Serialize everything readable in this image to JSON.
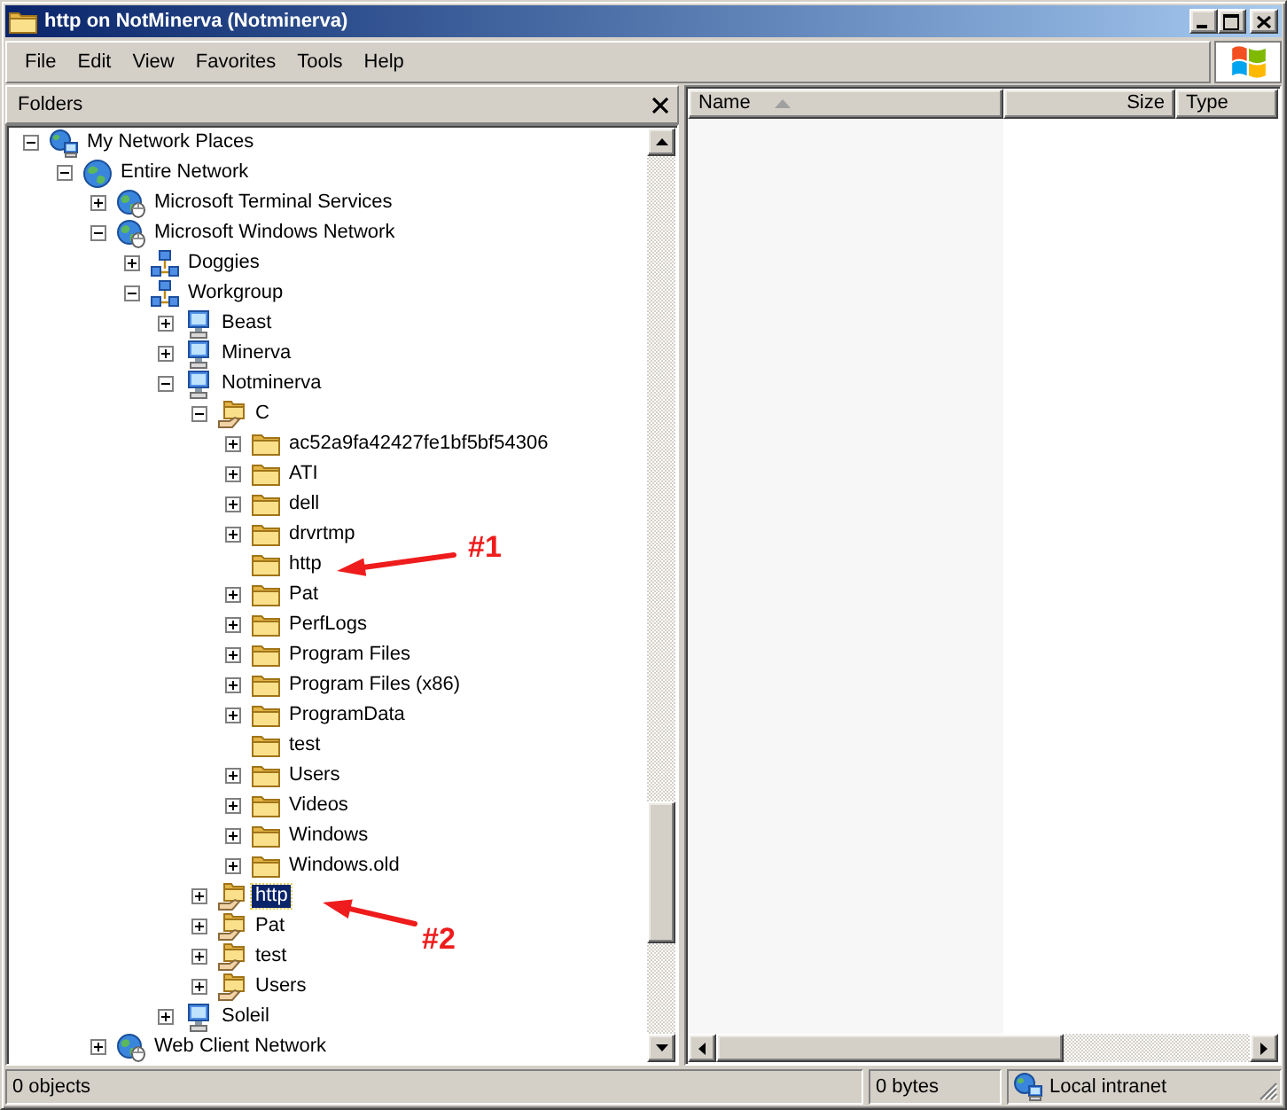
{
  "window": {
    "title": "http on NotMinerva (Notminerva)"
  },
  "menu": [
    "File",
    "Edit",
    "View",
    "Favorites",
    "Tools",
    "Help"
  ],
  "folders_pane": {
    "title": "Folders",
    "tree": [
      {
        "label": "My Network Places",
        "kind": "places",
        "expanded": true,
        "selected": false,
        "children": [
          {
            "label": "Entire Network",
            "kind": "globe",
            "expanded": true,
            "selected": false,
            "children": [
              {
                "label": "Microsoft Terminal Services",
                "kind": "network",
                "expanded": false,
                "selected": false
              },
              {
                "label": "Microsoft Windows Network",
                "kind": "network",
                "expanded": true,
                "selected": false,
                "children": [
                  {
                    "label": "Doggies",
                    "kind": "workgroup",
                    "expanded": false,
                    "selected": false
                  },
                  {
                    "label": "Workgroup",
                    "kind": "workgroup",
                    "expanded": true,
                    "selected": false,
                    "children": [
                      {
                        "label": "Beast",
                        "kind": "computer",
                        "expanded": false,
                        "selected": false
                      },
                      {
                        "label": "Minerva",
                        "kind": "computer",
                        "expanded": false,
                        "selected": false
                      },
                      {
                        "label": "Notminerva",
                        "kind": "computer",
                        "expanded": true,
                        "selected": false,
                        "children": [
                          {
                            "label": "C",
                            "kind": "share",
                            "expanded": true,
                            "selected": false,
                            "children": [
                              {
                                "label": "ac52a9fa42427fe1bf5bf54306",
                                "kind": "folder",
                                "expanded": false,
                                "selected": false
                              },
                              {
                                "label": "ATI",
                                "kind": "folder",
                                "expanded": false,
                                "selected": false
                              },
                              {
                                "label": "dell",
                                "kind": "folder",
                                "expanded": false,
                                "selected": false
                              },
                              {
                                "label": "drvrtmp",
                                "kind": "folder",
                                "expanded": false,
                                "selected": false
                              },
                              {
                                "label": "http",
                                "kind": "folder",
                                "selected": false
                              },
                              {
                                "label": "Pat",
                                "kind": "folder",
                                "expanded": false,
                                "selected": false
                              },
                              {
                                "label": "PerfLogs",
                                "kind": "folder",
                                "expanded": false,
                                "selected": false
                              },
                              {
                                "label": "Program Files",
                                "kind": "folder",
                                "expanded": false,
                                "selected": false
                              },
                              {
                                "label": "Program Files (x86)",
                                "kind": "folder",
                                "expanded": false,
                                "selected": false
                              },
                              {
                                "label": "ProgramData",
                                "kind": "folder",
                                "expanded": false,
                                "selected": false
                              },
                              {
                                "label": "test",
                                "kind": "folder",
                                "selected": false
                              },
                              {
                                "label": "Users",
                                "kind": "folder",
                                "expanded": false,
                                "selected": false
                              },
                              {
                                "label": "Videos",
                                "kind": "folder",
                                "expanded": false,
                                "selected": false
                              },
                              {
                                "label": "Windows",
                                "kind": "folder",
                                "expanded": false,
                                "selected": false
                              },
                              {
                                "label": "Windows.old",
                                "kind": "folder",
                                "expanded": false,
                                "selected": false
                              }
                            ]
                          },
                          {
                            "label": "http",
                            "kind": "share",
                            "expanded": false,
                            "selected": true
                          },
                          {
                            "label": "Pat",
                            "kind": "share",
                            "expanded": false,
                            "selected": false
                          },
                          {
                            "label": "test",
                            "kind": "share",
                            "expanded": false,
                            "selected": false
                          },
                          {
                            "label": "Users",
                            "kind": "share",
                            "expanded": false,
                            "selected": false
                          }
                        ]
                      },
                      {
                        "label": "Soleil",
                        "kind": "computer",
                        "expanded": false,
                        "selected": false
                      }
                    ]
                  }
                ]
              },
              {
                "label": "Web Client Network",
                "kind": "network",
                "expanded": false,
                "selected": false
              }
            ]
          }
        ]
      }
    ]
  },
  "list_view": {
    "columns": [
      {
        "label": "Name",
        "sorted": true
      },
      {
        "label": "Size",
        "sorted": false
      },
      {
        "label": "Type",
        "sorted": false
      }
    ]
  },
  "status_bar": {
    "objects": "0 objects",
    "size": "0 bytes",
    "zone": "Local intranet"
  },
  "annotations": [
    {
      "label": "#1"
    },
    {
      "label": "#2"
    }
  ]
}
